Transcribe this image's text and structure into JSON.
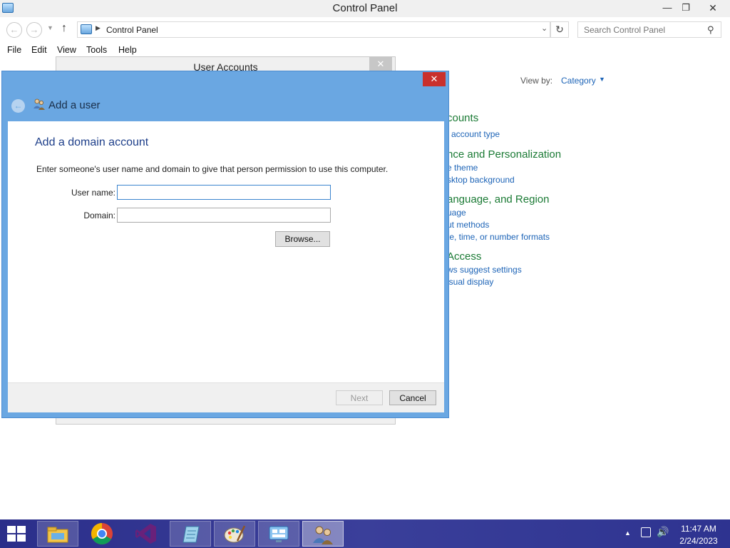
{
  "control_panel": {
    "title": "Control Panel",
    "address": "Control Panel",
    "search_placeholder": "Search Control Panel",
    "menu": [
      "File",
      "Edit",
      "View",
      "Tools",
      "Help"
    ],
    "view_by_label": "View by:",
    "view_by_value": "Category",
    "categories": [
      {
        "title": "counts",
        "links": [
          "account type"
        ]
      },
      {
        "title": "nce and Personalization",
        "links": [
          "e theme",
          "sktop background"
        ]
      },
      {
        "title": "anguage, and Region",
        "links": [
          "uage",
          "ut methods",
          "te, time, or number formats"
        ]
      },
      {
        "title": "Access",
        "links": [
          "ws suggest settings",
          "isual display"
        ]
      }
    ]
  },
  "user_accounts_window": {
    "title": "User Accounts"
  },
  "add_user_dialog": {
    "title": "Add a user",
    "heading": "Add a domain account",
    "description": "Enter someone's user name and domain to give that person permission to use this computer.",
    "username_label": "User name:",
    "username_value": "",
    "domain_label": "Domain:",
    "domain_value": "",
    "browse_label": "Browse...",
    "next_label": "Next",
    "cancel_label": "Cancel"
  },
  "taskbar": {
    "apps": [
      "file-explorer",
      "chrome",
      "visual-studio",
      "notepad",
      "paint",
      "control-panel",
      "user-accounts"
    ],
    "time": "11:47 AM",
    "date": "2/24/2023"
  },
  "colors": {
    "dialog_frame": "#6aa7e2",
    "link": "#1d64b7",
    "category_title": "#1a7a34",
    "close_red": "#c9302c"
  }
}
